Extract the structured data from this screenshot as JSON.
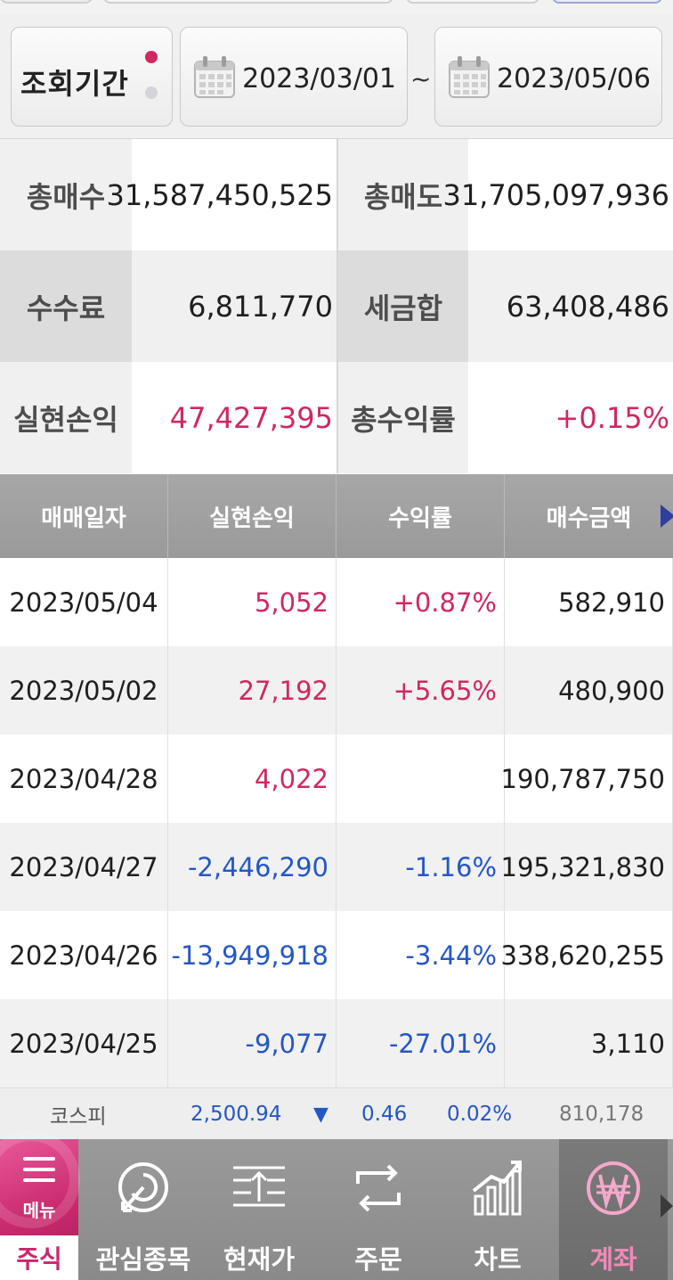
{
  "period": {
    "label": "조회기간",
    "start_date": "2023/03/01",
    "separator": "~",
    "end_date": "2023/05/06"
  },
  "summary": {
    "total_buy_label": "총매수",
    "total_buy_value": "31,587,450,525",
    "total_sell_label": "총매도",
    "total_sell_value": "31,705,097,936",
    "fee_label": "수수료",
    "fee_value": "6,811,770",
    "tax_label": "세금합",
    "tax_value": "63,408,486",
    "realized_pl_label": "실현손익",
    "realized_pl_value": "47,427,395",
    "total_return_label": "총수익률",
    "total_return_value": "+0.15%"
  },
  "table": {
    "headers": [
      "매매일자",
      "실현손익",
      "수익률",
      "매수금액"
    ],
    "rows": [
      {
        "date": "2023/05/04",
        "pl": "5,052",
        "rate": "+0.87%",
        "buy": "582,910",
        "sign": "pos"
      },
      {
        "date": "2023/05/02",
        "pl": "27,192",
        "rate": "+5.65%",
        "buy": "480,900",
        "sign": "pos"
      },
      {
        "date": "2023/04/28",
        "pl": "4,022",
        "rate": "",
        "buy": "190,787,750",
        "sign": "pos"
      },
      {
        "date": "2023/04/27",
        "pl": "-2,446,290",
        "rate": "-1.16%",
        "buy": "195,321,830",
        "sign": "neg"
      },
      {
        "date": "2023/04/26",
        "pl": "-13,949,918",
        "rate": "-3.44%",
        "buy": "338,620,255",
        "sign": "neg"
      },
      {
        "date": "2023/04/25",
        "pl": "-9,077",
        "rate": "-27.01%",
        "buy": "3,110",
        "sign": "neg"
      }
    ]
  },
  "ticker": {
    "name": "코스피",
    "index": "2,500.94",
    "direction": "▼",
    "change": "0.46",
    "rate": "0.02%",
    "volume": "810,178"
  },
  "nav": {
    "menu_label": "메뉴",
    "menu_sub": "주식",
    "items": [
      {
        "label": "관심종목",
        "icon": "watchlist-icon"
      },
      {
        "label": "현재가",
        "icon": "current-price-icon"
      },
      {
        "label": "주문",
        "icon": "order-icon"
      },
      {
        "label": "차트",
        "icon": "chart-icon"
      },
      {
        "label": "계좌",
        "icon": "won-account-icon"
      }
    ]
  },
  "colors": {
    "positive": "#d0285e",
    "negative": "#2457c5",
    "accent": "#c8286c"
  }
}
